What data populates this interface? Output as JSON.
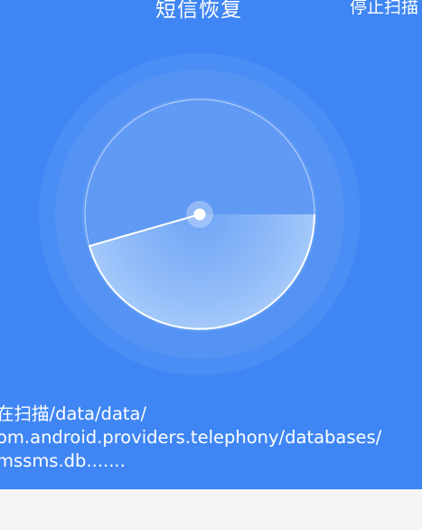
{
  "header": {
    "title": "短信恢复",
    "stop_scan_label": "停止扫描"
  },
  "scan": {
    "path_lines": [
      "在扫描/data/data/",
      "om.android.providers.telephony/databases/",
      "mssms.db......."
    ]
  },
  "colors": {
    "background": "#3f86f4",
    "bottom_bar": "#f5f5f5",
    "text": "#ffffff"
  },
  "icons": {
    "radar": "radar-scanner-icon",
    "radar_center": "radar-center-dot-icon"
  }
}
